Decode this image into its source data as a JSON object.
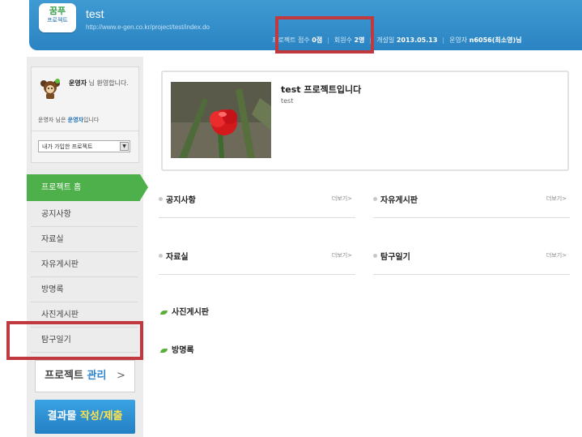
{
  "header": {
    "logo_line1": "꿈푸",
    "logo_line2": "프로젝트",
    "project_title": "test",
    "project_url": "http://www.e-gen.co.kr/project/test/index.do",
    "stats": {
      "score_label": "프로젝트 점수",
      "score_value": "0점",
      "members_label": "회원수",
      "members_value": "2명",
      "opened_label": "개설일",
      "opened_value": "2013.05.13",
      "operator_label": "운영자",
      "operator_value": "n6056(최소영)님"
    }
  },
  "profile": {
    "user_name": "운영자",
    "welcome_text": "님 환영합니다.",
    "role_prefix": "운영자 님은",
    "role_name": "운영자",
    "role_suffix": "입니다",
    "project_select": "내가 가입한 프로젝트"
  },
  "menu": {
    "home": "프로젝트 홈",
    "items": [
      "공지사항",
      "자료실",
      "자유게시판",
      "방명록",
      "사진게시판",
      "탐구일기"
    ],
    "manage_prefix": "프로젝트",
    "manage_accent": "관리",
    "manage_chevron": ">",
    "submit_prefix": "결과물",
    "submit_accent": "작성/제출"
  },
  "intro": {
    "title": "test 프로젝트입니다",
    "subtitle": "test"
  },
  "boards": {
    "more_label": "더보기>",
    "notice": "공지사항",
    "free": "자유게시판",
    "library": "자료실",
    "diary": "탐구일기",
    "photo": "사진게시판",
    "guestbook": "방명록"
  },
  "colors": {
    "header_blue": "#2b84c2",
    "menu_green": "#4db04a",
    "highlight_red": "#c0393f",
    "accent_yellow": "#ffe24a"
  }
}
